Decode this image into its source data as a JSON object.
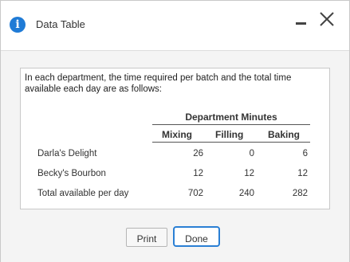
{
  "window": {
    "title": "Data Table",
    "info_glyph": "i",
    "minimize_icon": "minimize-icon",
    "close_icon": "close-icon"
  },
  "content": {
    "intro": "In each department, the time required per batch and the total time available each day are as follows:",
    "table": {
      "group_header": "Department Minutes",
      "columns": [
        "Mixing",
        "Filling",
        "Baking"
      ],
      "rows": [
        {
          "label": "Darla's Delight",
          "values": [
            "26",
            "0",
            "6"
          ]
        },
        {
          "label": "Becky's Bourbon",
          "values": [
            "12",
            "12",
            "12"
          ]
        },
        {
          "label": "Total available per day",
          "values": [
            "702",
            "240",
            "282"
          ]
        }
      ]
    }
  },
  "buttons": {
    "print": "Print",
    "done": "Done"
  },
  "colors": {
    "info_icon": "#1f7bd6",
    "focus_border": "#2a7fd4"
  }
}
